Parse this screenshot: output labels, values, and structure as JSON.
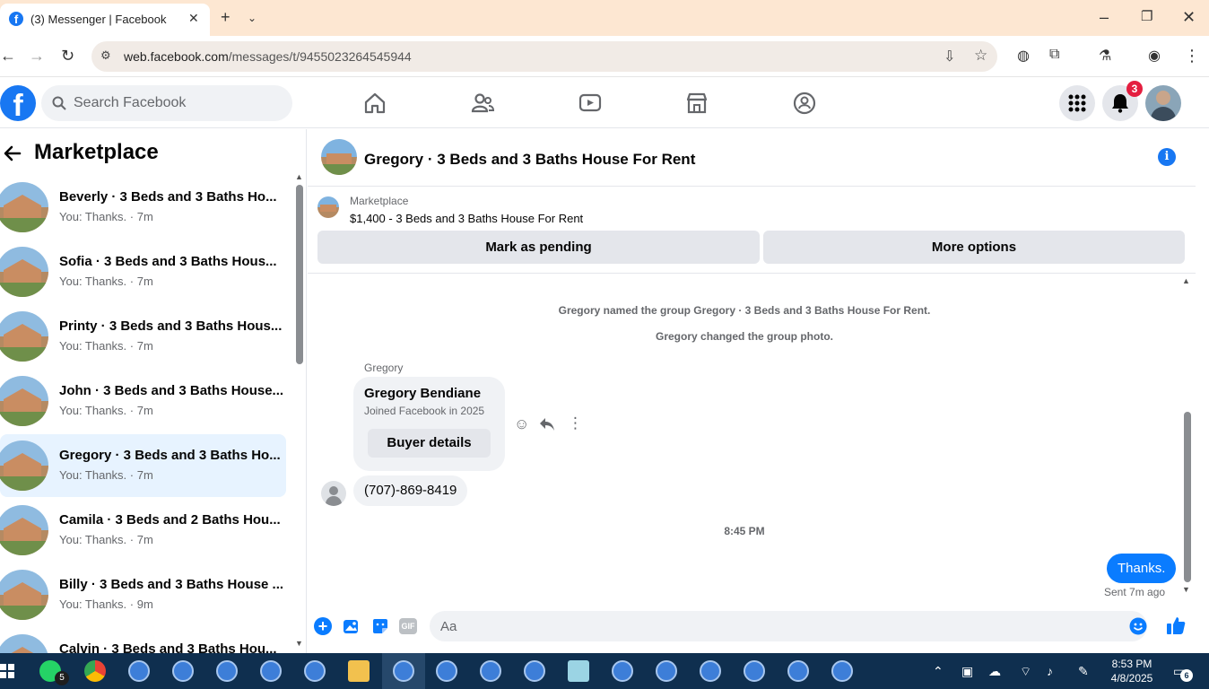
{
  "browser": {
    "tab_title": "(3) Messenger | Facebook",
    "url_host": "web.facebook.com",
    "url_path": "/messages/t/9455023264545944"
  },
  "fb": {
    "search_placeholder": "Search Facebook",
    "notification_count": "3"
  },
  "left_panel": {
    "title": "Marketplace",
    "conversations": [
      {
        "name": "Beverly · 3 Beds and 3 Baths Ho...",
        "preview": "You: Thanks. · 7m",
        "active": false
      },
      {
        "name": "Sofia · 3 Beds and 3 Baths Hous...",
        "preview": "You: Thanks. · 7m",
        "active": false
      },
      {
        "name": "Printy · 3 Beds and 3 Baths Hous...",
        "preview": "You: Thanks. · 7m",
        "active": false
      },
      {
        "name": "John · 3 Beds and 3 Baths House...",
        "preview": "You: Thanks. · 7m",
        "active": false
      },
      {
        "name": "Gregory · 3 Beds and 3 Baths Ho...",
        "preview": "You: Thanks. · 7m",
        "active": true
      },
      {
        "name": "Camila · 3 Beds and 2 Baths Hou...",
        "preview": "You: Thanks. · 7m",
        "active": false
      },
      {
        "name": "Billy · 3 Beds and 3 Baths House ...",
        "preview": "You: Thanks. · 9m",
        "active": false
      },
      {
        "name": "Calvin · 3 Beds and 3 Baths Hou...",
        "preview": "",
        "active": false
      }
    ]
  },
  "chat": {
    "title": "Gregory · 3 Beds and 3 Baths House For Rent",
    "marketplace_label": "Marketplace",
    "listing": "$1,400 - 3 Beds and 3 Baths House For Rent",
    "mark_pending_label": "Mark as pending",
    "more_options_label": "More options",
    "system_msg_1": "Gregory named the group Gregory · 3 Beds and 3 Baths House For Rent.",
    "system_msg_2": "Gregory changed the group photo.",
    "sender_name": "Gregory",
    "card_name": "Gregory Bendiane",
    "card_joined": "Joined Facebook in 2025",
    "buyer_details_label": "Buyer details",
    "phone_message": "(707)-869-8419",
    "timestamp": "8:45 PM",
    "sent_message": "Thanks.",
    "sent_status": "Sent 7m ago",
    "composer_placeholder": "Aa"
  },
  "taskbar": {
    "time": "8:53 PM",
    "date": "4/8/2025",
    "whatsapp_count": "5",
    "notif_count": "6"
  },
  "colors": {
    "fb_blue": "#1877f2",
    "messenger_blue": "#0a7cff",
    "active_row": "#e7f3ff",
    "tabbar": "#fde7d2"
  }
}
